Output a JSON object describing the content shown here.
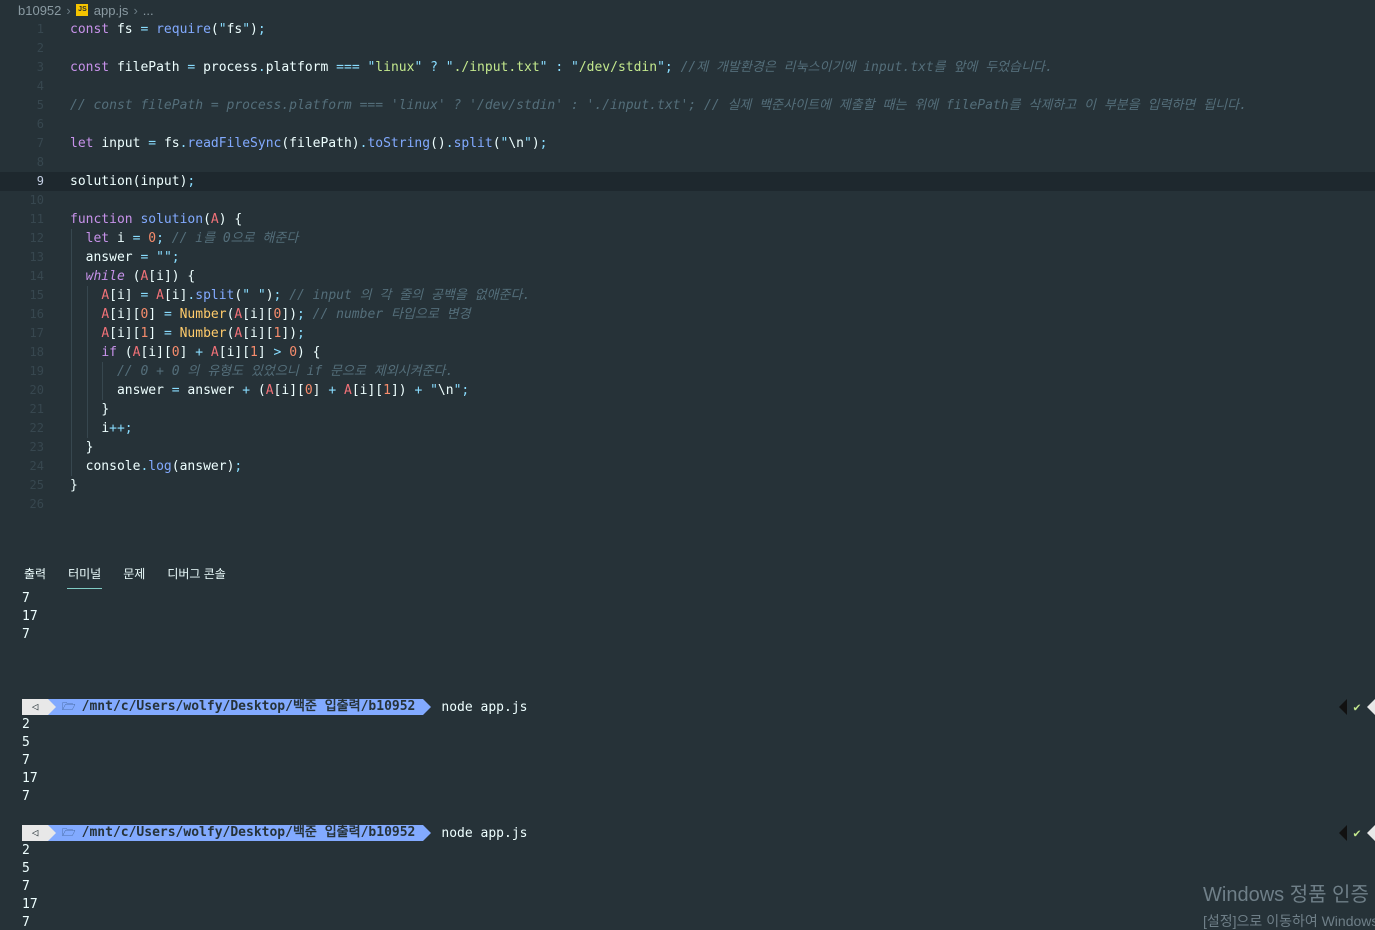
{
  "breadcrumb": {
    "folder": "b10952",
    "file": "app.js",
    "more": "..."
  },
  "editor": {
    "line_numbers": [
      "1",
      "2",
      "3",
      "4",
      "5",
      "6",
      "7",
      "8",
      "9",
      "10",
      "11",
      "12",
      "13",
      "14",
      "15",
      "16",
      "17",
      "18",
      "19",
      "20",
      "21",
      "22",
      "23",
      "24",
      "25",
      "26"
    ],
    "active_line": 9,
    "lines": [
      "const fs = require(\"fs\");",
      "",
      "const filePath = process.platform === \"linux\" ? \"./input.txt\" : \"/dev/stdin\"; //제 개발환경은 리눅스이기에 input.txt를 앞에 두었습니다.",
      "",
      "// const filePath = process.platform === 'linux' ? '/dev/stdin' : './input.txt'; // 실제 백준사이트에 제출할 때는 위에 filePath를 삭제하고 이 부분을 입력하면 됩니다.",
      "",
      "let input = fs.readFileSync(filePath).toString().split(\"\\n\");",
      "",
      "solution(input);",
      "",
      "function solution(A) {",
      "  let i = 0; // i를 0으로 해준다",
      "  answer = \"\";",
      "  while (A[i]) {",
      "    A[i] = A[i].split(\" \"); // input 의 각 줄의 공백을 없애준다.",
      "    A[i][0] = Number(A[i][0]); // number 타입으로 변경",
      "    A[i][1] = Number(A[i][1]);",
      "    if (A[i][0] + A[i][1] > 0) {",
      "      // 0 + 0 의 유형도 있었으니 if 문으로 제외시켜준다.",
      "      answer = answer + (A[i][0] + A[i][1]) + \"\\n\";",
      "    }",
      "    i++;",
      "  }",
      "  console.log(answer);",
      "}",
      ""
    ]
  },
  "panel": {
    "tabs": [
      "출력",
      "터미널",
      "문제",
      "디버그 콘솔"
    ],
    "active_tab": "터미널"
  },
  "terminal": {
    "initial_output": [
      "7",
      "17",
      "7"
    ],
    "runs": [
      {
        "prompt_icon": "◁",
        "folder_icon": "🗁",
        "path": "/mnt/c/Users/wolfy/Desktop/백준 입출력/b10952",
        "command": "node app.js",
        "status": "✔",
        "output": [
          "2",
          "5",
          "7",
          "17",
          "7"
        ]
      },
      {
        "prompt_icon": "◁",
        "folder_icon": "🗁",
        "path": "/mnt/c/Users/wolfy/Desktop/백준 입출력/b10952",
        "command": "node app.js",
        "status": "✔",
        "output": [
          "2",
          "5",
          "7",
          "17",
          "7"
        ]
      }
    ]
  },
  "watermark": {
    "line1": "Windows 정품 인증",
    "line2": "[설정]으로 이동하여 Windows"
  },
  "colors": {
    "background": "#263238",
    "keyword": "#c792ea",
    "function": "#82aaff",
    "string": "#c3e88d",
    "number": "#f78c6c",
    "comment": "#546e7a",
    "accent": "#80cbc4"
  }
}
